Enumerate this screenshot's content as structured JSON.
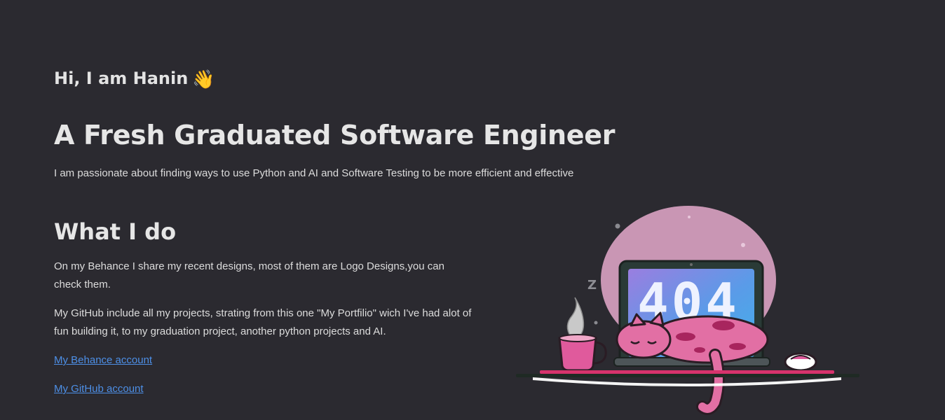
{
  "hero": {
    "greeting": "Hi, I am Hanin",
    "wave_emoji": "👋",
    "headline": "A Fresh Graduated Software Engineer",
    "intro": "I am passionate about finding ways to use Python and AI and Software Testing to be more efficient and effective"
  },
  "what_i_do": {
    "title": "What I do",
    "paragraphs": [
      "On my Behance I share my recent designs, most of them are Logo Designs,you can check them.",
      "My GitHub include all my projects, strating from this one \"My Portfilio\" wich I've had alot of fun building it, to my graduation project, another python projects and AI."
    ],
    "links": [
      "My Behance account",
      "My GitHub account"
    ]
  },
  "illustration": {
    "screen_text": "404",
    "sleep_text": "Z",
    "icon": "sleeping-cat-laptop-illustration"
  },
  "colors": {
    "background": "#2b2a30",
    "text": "#e4e4e4",
    "link": "#4d8fe6",
    "accent_pink": "#e05a9c"
  }
}
